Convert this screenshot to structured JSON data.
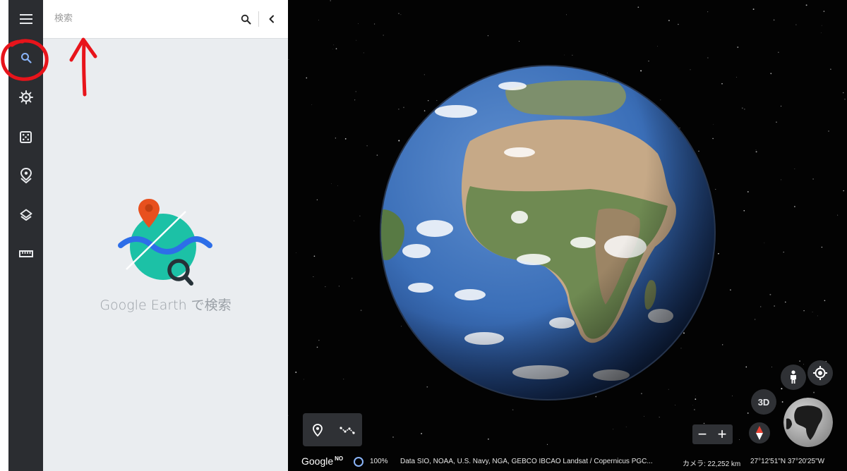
{
  "search": {
    "placeholder": "検索"
  },
  "empty_state": {
    "text": "Google Earth で検索"
  },
  "rail": {
    "items": [
      {
        "icon": "menu-icon"
      },
      {
        "icon": "search-icon",
        "active": true
      },
      {
        "icon": "voyager-icon"
      },
      {
        "icon": "dice-icon"
      },
      {
        "icon": "projects-icon"
      },
      {
        "icon": "layers-icon"
      },
      {
        "icon": "ruler-icon"
      }
    ]
  },
  "map": {
    "btn_3d": "3D",
    "zoom_out": "−",
    "zoom_in": "+"
  },
  "footer": {
    "logo": "Google",
    "logo_badge": "NO",
    "zoom_percent": "100%",
    "attribution": "Data SIO, NOAA, U.S. Navy, NGA, GEBCO  IBCAO  Landsat / Copernicus  PGC...",
    "camera": "カメラ: 22,252 km",
    "coordinates": "27°12'51\"N 37°20'25\"W"
  },
  "colors": {
    "rail_bg": "#2b2d31",
    "panel_bg": "#eaedf0",
    "active_icon": "#8ab4f8",
    "annotation_red": "#e8141b",
    "pin_orange": "#e8501e",
    "teal": "#1cc1a6",
    "wave_blue": "#2d6ee8"
  }
}
